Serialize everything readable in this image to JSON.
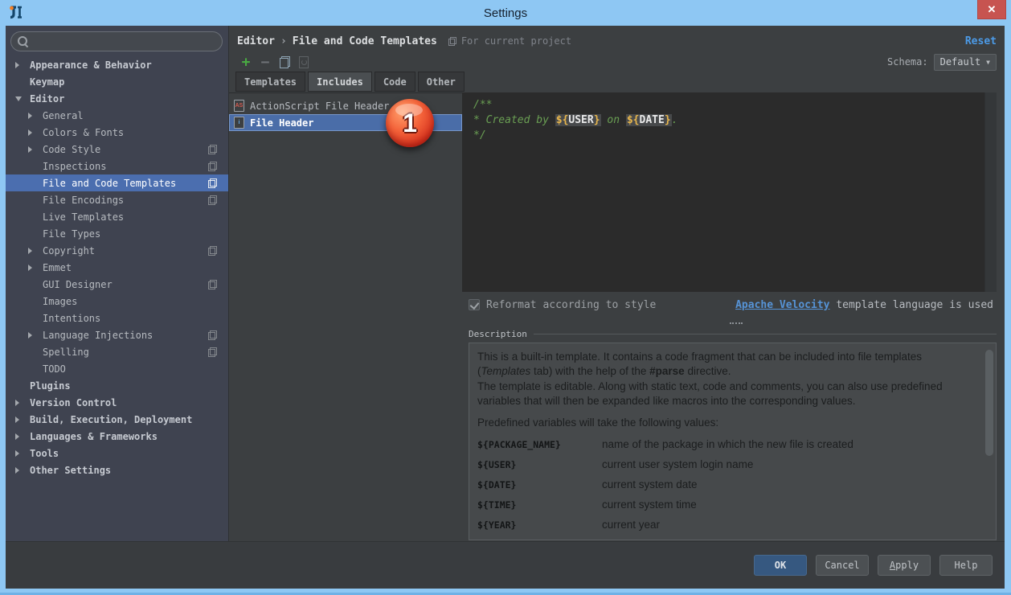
{
  "window": {
    "title": "Settings",
    "close_icon": "✕"
  },
  "sidebar": {
    "tree": [
      {
        "label": "Appearance & Behavior"
      },
      {
        "label": "Keymap"
      },
      {
        "label": "Editor"
      },
      {
        "label": "General"
      },
      {
        "label": "Colors & Fonts"
      },
      {
        "label": "Code Style"
      },
      {
        "label": "Inspections"
      },
      {
        "label": "File and Code Templates"
      },
      {
        "label": "File Encodings"
      },
      {
        "label": "Live Templates"
      },
      {
        "label": "File Types"
      },
      {
        "label": "Copyright"
      },
      {
        "label": "Emmet"
      },
      {
        "label": "GUI Designer"
      },
      {
        "label": "Images"
      },
      {
        "label": "Intentions"
      },
      {
        "label": "Language Injections"
      },
      {
        "label": "Spelling"
      },
      {
        "label": "TODO"
      },
      {
        "label": "Plugins"
      },
      {
        "label": "Version Control"
      },
      {
        "label": "Build, Execution, Deployment"
      },
      {
        "label": "Languages & Frameworks"
      },
      {
        "label": "Tools"
      },
      {
        "label": "Other Settings"
      }
    ]
  },
  "header": {
    "breadcrumb": [
      "Editor",
      "File and Code Templates"
    ],
    "separator": "›",
    "scope_note": "For current project",
    "reset_label": "Reset"
  },
  "toolbar": {
    "plus_icon": "+",
    "minus_icon": "−",
    "schema_label": "Schema:",
    "schema_value": "Default",
    "caret_icon": "▼"
  },
  "tabs": [
    {
      "label": "Templates"
    },
    {
      "label": "Includes"
    },
    {
      "label": "Code"
    },
    {
      "label": "Other"
    }
  ],
  "list": {
    "items": [
      {
        "icon_text": "AS",
        "label": "ActionScript File Header"
      },
      {
        "icon_text": "i",
        "label": "File Header"
      }
    ]
  },
  "badge": {
    "value": "1"
  },
  "editor": {
    "line1": "/**",
    "line2_prefix": " * Created by ",
    "var1_open": "${",
    "var1_name": "USER",
    "var1_close": "}",
    "line2_mid": " on ",
    "var2_open": "${",
    "var2_name": "DATE",
    "var2_close": "}",
    "line2_suffix": ".",
    "line3": " */"
  },
  "options": {
    "reformat_label": "Reformat according to style",
    "link_label": "Apache Velocity",
    "link_suffix": " template language is used"
  },
  "description": {
    "title": "Description",
    "p1a": "This is a built-in template. It contains a code fragment that can be included into file templates (",
    "p1b": "Templates",
    "p1c": " tab) with the help of the ",
    "p1d": "#parse",
    "p1e": " directive.",
    "p2": "The template is editable. Along with static text, code and comments, you can also use predefined variables that will then be expanded like macros into the corresponding values.",
    "p3": "Predefined variables will take the following values:",
    "variables": [
      {
        "name": "${PACKAGE_NAME}",
        "desc": "name of the package in which the new file is created"
      },
      {
        "name": "${USER}",
        "desc": "current user system login name"
      },
      {
        "name": "${DATE}",
        "desc": "current system date"
      },
      {
        "name": "${TIME}",
        "desc": "current system time"
      },
      {
        "name": "${YEAR}",
        "desc": "current year"
      }
    ]
  },
  "footer": {
    "ok": "OK",
    "cancel": "Cancel",
    "apply_initial": "A",
    "apply_rest": "pply",
    "help": "Help"
  },
  "colors": {
    "titlebar": "#8EC7F3",
    "selection_blue": "#4B6EAF",
    "link_blue": "#5693D6",
    "close_red": "#C75450",
    "plus_green": "#49A942",
    "comment_green": "#6A9F53",
    "variable_orange": "#E8B64C",
    "ok_button": "#365880",
    "badge_red": "#E0402A",
    "editor_bg": "#2B2B2B"
  }
}
